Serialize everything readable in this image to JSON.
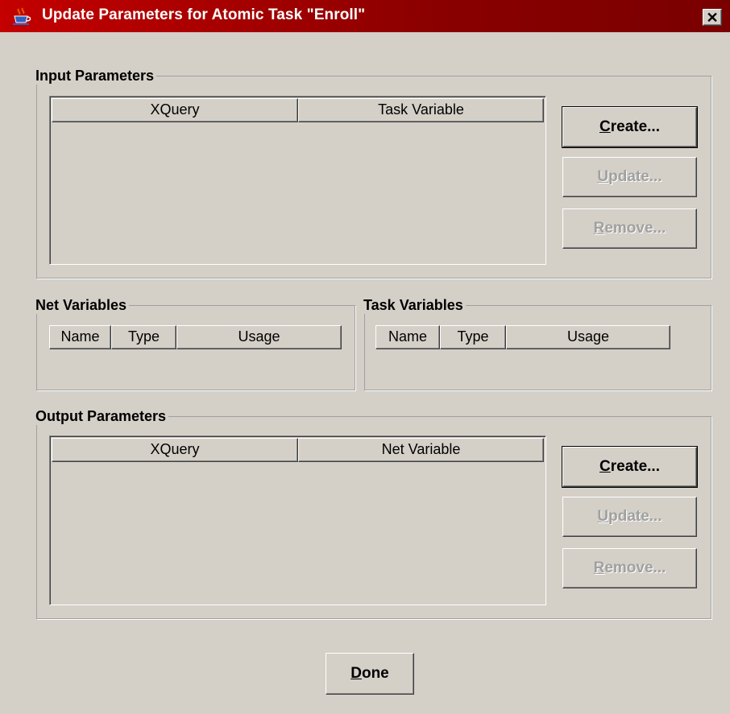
{
  "window": {
    "title": "Update Parameters for Atomic Task \"Enroll\"",
    "icon": "java-cup-icon",
    "close_label": "✕"
  },
  "input_parameters": {
    "legend": "Input Parameters",
    "columns": [
      "XQuery",
      "Task Variable"
    ],
    "rows": [],
    "buttons": {
      "create": {
        "mnemonic": "C",
        "rest": "reate...",
        "enabled": true
      },
      "update": {
        "mnemonic": "U",
        "rest": "pdate...",
        "enabled": false
      },
      "remove": {
        "mnemonic": "R",
        "rest": "emove...",
        "enabled": false
      }
    }
  },
  "net_variables": {
    "legend": "Net Variables",
    "columns": [
      "Name",
      "Type",
      "Usage"
    ]
  },
  "task_variables": {
    "legend": "Task Variables",
    "columns": [
      "Name",
      "Type",
      "Usage"
    ]
  },
  "output_parameters": {
    "legend": "Output Parameters",
    "columns": [
      "XQuery",
      "Net Variable"
    ],
    "rows": [],
    "buttons": {
      "create": {
        "mnemonic": "C",
        "rest": "reate...",
        "enabled": true
      },
      "update": {
        "mnemonic": "U",
        "rest": "pdate...",
        "enabled": false
      },
      "remove": {
        "mnemonic": "R",
        "rest": "emove...",
        "enabled": false
      }
    }
  },
  "footer": {
    "done": {
      "mnemonic": "D",
      "rest": "one"
    }
  },
  "colors": {
    "titlebar_start": "#c40000",
    "titlebar_end": "#7a0000",
    "window_bg": "#d4d0c8",
    "disabled_text": "#a0a0a0"
  }
}
